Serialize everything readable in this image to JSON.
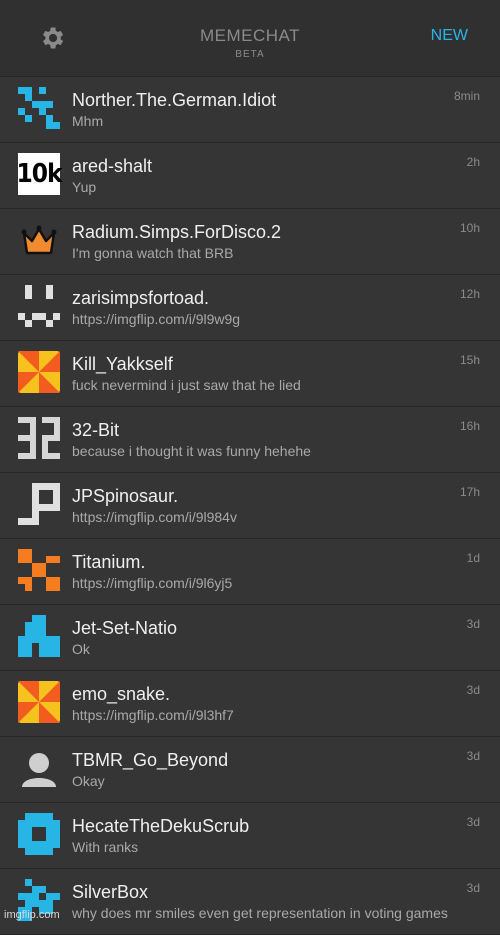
{
  "header": {
    "title": "MEMECHAT",
    "subtitle": "BETA",
    "new_label": "NEW",
    "accent_color": "#27b5e6",
    "settings_icon": "gear-icon"
  },
  "conversations": [
    {
      "name": "Norther.The.German.Idiot",
      "message": "Mhm",
      "time": "8min",
      "avatar": "blue-pixel-icon"
    },
    {
      "name": "ared-shalt",
      "message": "Yup",
      "time": "2h",
      "avatar": "10k-text-avatar",
      "avatar_text": "10k"
    },
    {
      "name": "Radium.Simps.ForDisco.2",
      "message": "I'm gonna watch that BRB",
      "time": "10h",
      "avatar": "crown-icon"
    },
    {
      "name": "zarisimpsfortoad.",
      "message": "https://imgflip.com/i/9l9w9g",
      "time": "12h",
      "avatar": "white-pixel-face-icon"
    },
    {
      "name": "Kill_Yakkself",
      "message": "fuck nevermind i just saw that he lied",
      "time": "15h",
      "avatar": "pinwheel-icon"
    },
    {
      "name": "32-Bit",
      "message": "because i thought it was funny hehehe",
      "time": "16h",
      "avatar": "32-pixel-icon"
    },
    {
      "name": "JPSpinosaur.",
      "message": "https://imgflip.com/i/9l984v",
      "time": "17h",
      "avatar": "white-pixel-p-icon"
    },
    {
      "name": "Titanium.",
      "message": "https://imgflip.com/i/9l6yj5",
      "time": "1d",
      "avatar": "orange-pixel-icon"
    },
    {
      "name": "Jet-Set-Natio",
      "message": "Ok",
      "time": "3d",
      "avatar": "blue-pixel-house-icon"
    },
    {
      "name": "emo_snake.",
      "message": "https://imgflip.com/i/9l3hf7",
      "time": "3d",
      "avatar": "pinwheel-icon"
    },
    {
      "name": "TBMR_Go_Beyond",
      "message": "Okay",
      "time": "3d",
      "avatar": "default-user-icon"
    },
    {
      "name": "HecateTheDekuScrub",
      "message": "With ranks",
      "time": "3d",
      "avatar": "blue-pixel-cross-icon"
    },
    {
      "name": "SilverBox",
      "message": "why does mr smiles even get representation in voting games",
      "time": "3d",
      "avatar": "blue-pixel-icon"
    }
  ],
  "watermark": "imgflip.com"
}
